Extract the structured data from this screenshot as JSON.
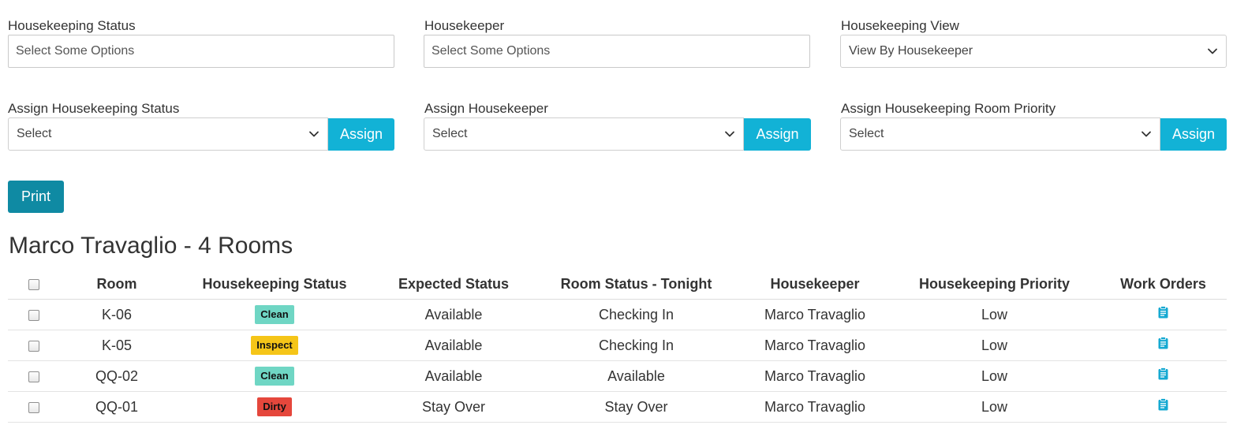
{
  "filters": {
    "housekeeping_status": {
      "label": "Housekeeping Status",
      "placeholder": "Select Some Options"
    },
    "housekeeper": {
      "label": "Housekeeper",
      "placeholder": "Select Some Options"
    },
    "housekeeping_view": {
      "label": "Housekeeping View",
      "value": "View By Housekeeper"
    }
  },
  "assign": {
    "status": {
      "label": "Assign Housekeeping Status",
      "value": "Select",
      "button": "Assign"
    },
    "housekeeper": {
      "label": "Assign Housekeeper",
      "value": "Select",
      "button": "Assign"
    },
    "priority": {
      "label": "Assign Housekeeping Room Priority",
      "value": "Select",
      "button": "Assign"
    }
  },
  "print_label": "Print",
  "group": {
    "title": "Marco Travaglio - 4 Rooms",
    "columns": [
      "Room",
      "Housekeeping Status",
      "Expected Status",
      "Room Status - Tonight",
      "Housekeeper",
      "Housekeeping Priority",
      "Work Orders"
    ],
    "rows": [
      {
        "room": "K-06",
        "status": "Clean",
        "status_color": "#6fd6c4",
        "expected": "Available",
        "tonight": "Checking In",
        "housekeeper": "Marco Travaglio",
        "priority": "Low",
        "work_order_icon": "clipboard-icon"
      },
      {
        "room": "K-05",
        "status": "Inspect",
        "status_color": "#f5c518",
        "expected": "Available",
        "tonight": "Checking In",
        "housekeeper": "Marco Travaglio",
        "priority": "Low",
        "work_order_icon": "clipboard-icon"
      },
      {
        "room": "QQ-02",
        "status": "Clean",
        "status_color": "#6fd6c4",
        "expected": "Available",
        "tonight": "Available",
        "housekeeper": "Marco Travaglio",
        "priority": "Low",
        "work_order_icon": "clipboard-icon"
      },
      {
        "room": "QQ-01",
        "status": "Dirty",
        "status_color": "#e5473c",
        "expected": "Stay Over",
        "tonight": "Stay Over",
        "housekeeper": "Marco Travaglio",
        "priority": "Low",
        "work_order_icon": "clipboard-icon"
      }
    ]
  },
  "colors": {
    "assign_button": "#12b2d6",
    "print_button": "#0f8aa3",
    "icon": "#15a9d2"
  }
}
